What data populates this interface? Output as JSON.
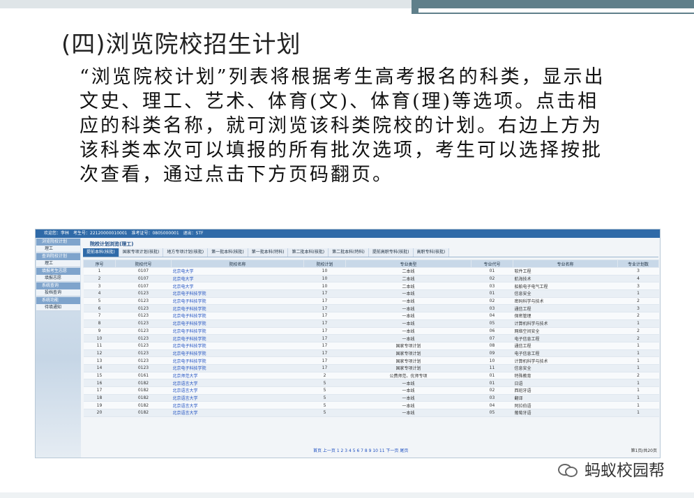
{
  "slide": {
    "title": "(四)浏览院校招生计划",
    "body": "“浏览院校计划”列表将根据考生高考报名的科类，显示出文史、理工、艺术、体育(文)、体育(理)等选项。点击相应的科类名称，就可浏览该科类院校的计划。右边上方为该科类本次可以填报的所有批次选项，考生可以选择按批次查看，通过点击下方页码翻页。"
  },
  "app": {
    "topbar": [
      "欢迎您：李林",
      "考生号：22120000010001",
      "准考证号：0805000001",
      "退出：STF"
    ],
    "sidebar": [
      {
        "section": "浏览院校计划",
        "items": [
          "理工"
        ]
      },
      {
        "section": "查询院校计划",
        "items": [
          "理工"
        ]
      },
      {
        "section": "填报考生志愿",
        "items": [
          "填报志愿"
        ]
      },
      {
        "section": "系统查询",
        "items": [
          "投档查询"
        ]
      },
      {
        "section": "系统功能",
        "items": [
          "待填通知"
        ]
      }
    ],
    "breadcrumb": "院校计划浏览(理工)",
    "tabs": [
      "提前本科(核批)",
      "国家专项计划(核批)",
      "地方专项计划(核批)",
      "第一批本科(核批)",
      "第一批本科(特科)",
      "第二批本科(核批)",
      "第二批本科(特科)",
      "提前高职专科(核批)",
      "高职专科(核批)"
    ],
    "active_tab": 0,
    "columns": [
      "序号",
      "院校代号",
      "院校名称",
      "院校计划",
      "专业类型",
      "专业代号",
      "专业名称",
      "专业计划数"
    ],
    "rows": [
      [
        "1",
        "0107",
        "北京电大学",
        "10",
        "二本线",
        "01",
        "软件工程",
        "3"
      ],
      [
        "2",
        "0107",
        "北京电大学",
        "10",
        "二本线",
        "02",
        "航海技术",
        "4"
      ],
      [
        "3",
        "0107",
        "北京电大学",
        "10",
        "二本线",
        "03",
        "船舶电子电气工程",
        "3"
      ],
      [
        "4",
        "0123",
        "北京电子科技学院",
        "17",
        "一本线",
        "01",
        "信息安全",
        "1"
      ],
      [
        "5",
        "0123",
        "北京电子科技学院",
        "17",
        "一本线",
        "02",
        "密码科学与技术",
        "2"
      ],
      [
        "6",
        "0123",
        "北京电子科技学院",
        "17",
        "一本线",
        "03",
        "通信工程",
        "3"
      ],
      [
        "7",
        "0123",
        "北京电子科技学院",
        "17",
        "一本线",
        "04",
        "保密管理",
        "2"
      ],
      [
        "8",
        "0123",
        "北京电子科技学院",
        "17",
        "一本线",
        "05",
        "计算机科学与技术",
        "1"
      ],
      [
        "9",
        "0123",
        "北京电子科技学院",
        "17",
        "一本线",
        "06",
        "网络空间安全",
        "2"
      ],
      [
        "10",
        "0123",
        "北京电子科技学院",
        "17",
        "一本线",
        "07",
        "电子信息工程",
        "2"
      ],
      [
        "11",
        "0123",
        "北京电子科技学院",
        "17",
        "国家专项计划",
        "08",
        "通信工程",
        "1"
      ],
      [
        "12",
        "0123",
        "北京电子科技学院",
        "17",
        "国家专项计划",
        "09",
        "电子信息工程",
        "1"
      ],
      [
        "13",
        "0123",
        "北京电子科技学院",
        "17",
        "国家专项计划",
        "10",
        "计算机科学与技术",
        "1"
      ],
      [
        "14",
        "0123",
        "北京电子科技学院",
        "17",
        "国家专项计划",
        "11",
        "信息安全",
        "1"
      ],
      [
        "15",
        "0161",
        "北京师范大学",
        "2",
        "公费师范、优师专项",
        "01",
        "特殊教育",
        "2"
      ],
      [
        "16",
        "0182",
        "北京语言大学",
        "5",
        "一本线",
        "01",
        "日语",
        "1"
      ],
      [
        "17",
        "0182",
        "北京语言大学",
        "5",
        "一本线",
        "02",
        "西班牙语",
        "1"
      ],
      [
        "18",
        "0182",
        "北京语言大学",
        "5",
        "一本线",
        "03",
        "翻译",
        "1"
      ],
      [
        "19",
        "0182",
        "北京语言大学",
        "5",
        "一本线",
        "04",
        "阿拉伯语",
        "1"
      ],
      [
        "20",
        "0182",
        "北京语言大学",
        "5",
        "一本线",
        "05",
        "葡萄牙语",
        "1"
      ]
    ],
    "pager": {
      "nav": "首页 上一页 1 2 3 4 5 6 7 8 9 10 11 下一页 尾页",
      "info": "第1页/共20页"
    }
  },
  "watermark": {
    "text": "蚂蚁校园帮",
    "icon": "wechat-icon"
  }
}
